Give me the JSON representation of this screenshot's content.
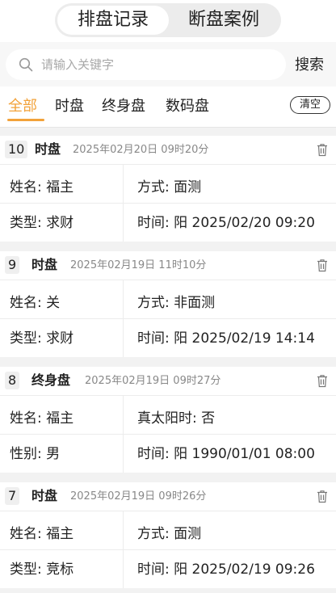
{
  "header": {
    "tabs": [
      {
        "label": "排盘记录",
        "active": true
      },
      {
        "label": "断盘案例",
        "active": false
      }
    ]
  },
  "search": {
    "placeholder": "请输入关键字",
    "value": "",
    "button_label": "搜索"
  },
  "filters": {
    "tabs": [
      {
        "label": "全部",
        "active": true
      },
      {
        "label": "时盘"
      },
      {
        "label": "终身盘"
      },
      {
        "label": "数码盘"
      }
    ],
    "clear_label": "清空"
  },
  "colors": {
    "accent": "#f2a23a",
    "background": "#f2f2f2",
    "card": "#ffffff",
    "muted_text": "#888888"
  },
  "icons": {
    "search": "search-icon",
    "delete": "trash-icon"
  },
  "records": [
    {
      "number": "10",
      "type": "时盘",
      "created": "2025年02月20日 09时20分",
      "row1_left": "姓名: 福主",
      "row1_right": "方式: 面测",
      "row2_left": "类型: 求财",
      "row2_right": "时间: 阳 2025/02/20 09:20"
    },
    {
      "number": "9",
      "type": "时盘",
      "created": "2025年02月19日 11时10分",
      "row1_left": "姓名: 关",
      "row1_right": "方式: 非面测",
      "row2_left": "类型: 求财",
      "row2_right": "时间: 阳 2025/02/19 14:14"
    },
    {
      "number": "8",
      "type": "终身盘",
      "created": "2025年02月19日 09时27分",
      "row1_left": "姓名: 福主",
      "row1_right": "真太阳时: 否",
      "row2_left": "性别: 男",
      "row2_right": "时间: 阳 1990/01/01 08:00"
    },
    {
      "number": "7",
      "type": "时盘",
      "created": "2025年02月19日 09时26分",
      "row1_left": "姓名: 福主",
      "row1_right": "方式: 面测",
      "row2_left": "类型: 竞标",
      "row2_right": "时间: 阳 2025/02/19 09:26"
    }
  ]
}
